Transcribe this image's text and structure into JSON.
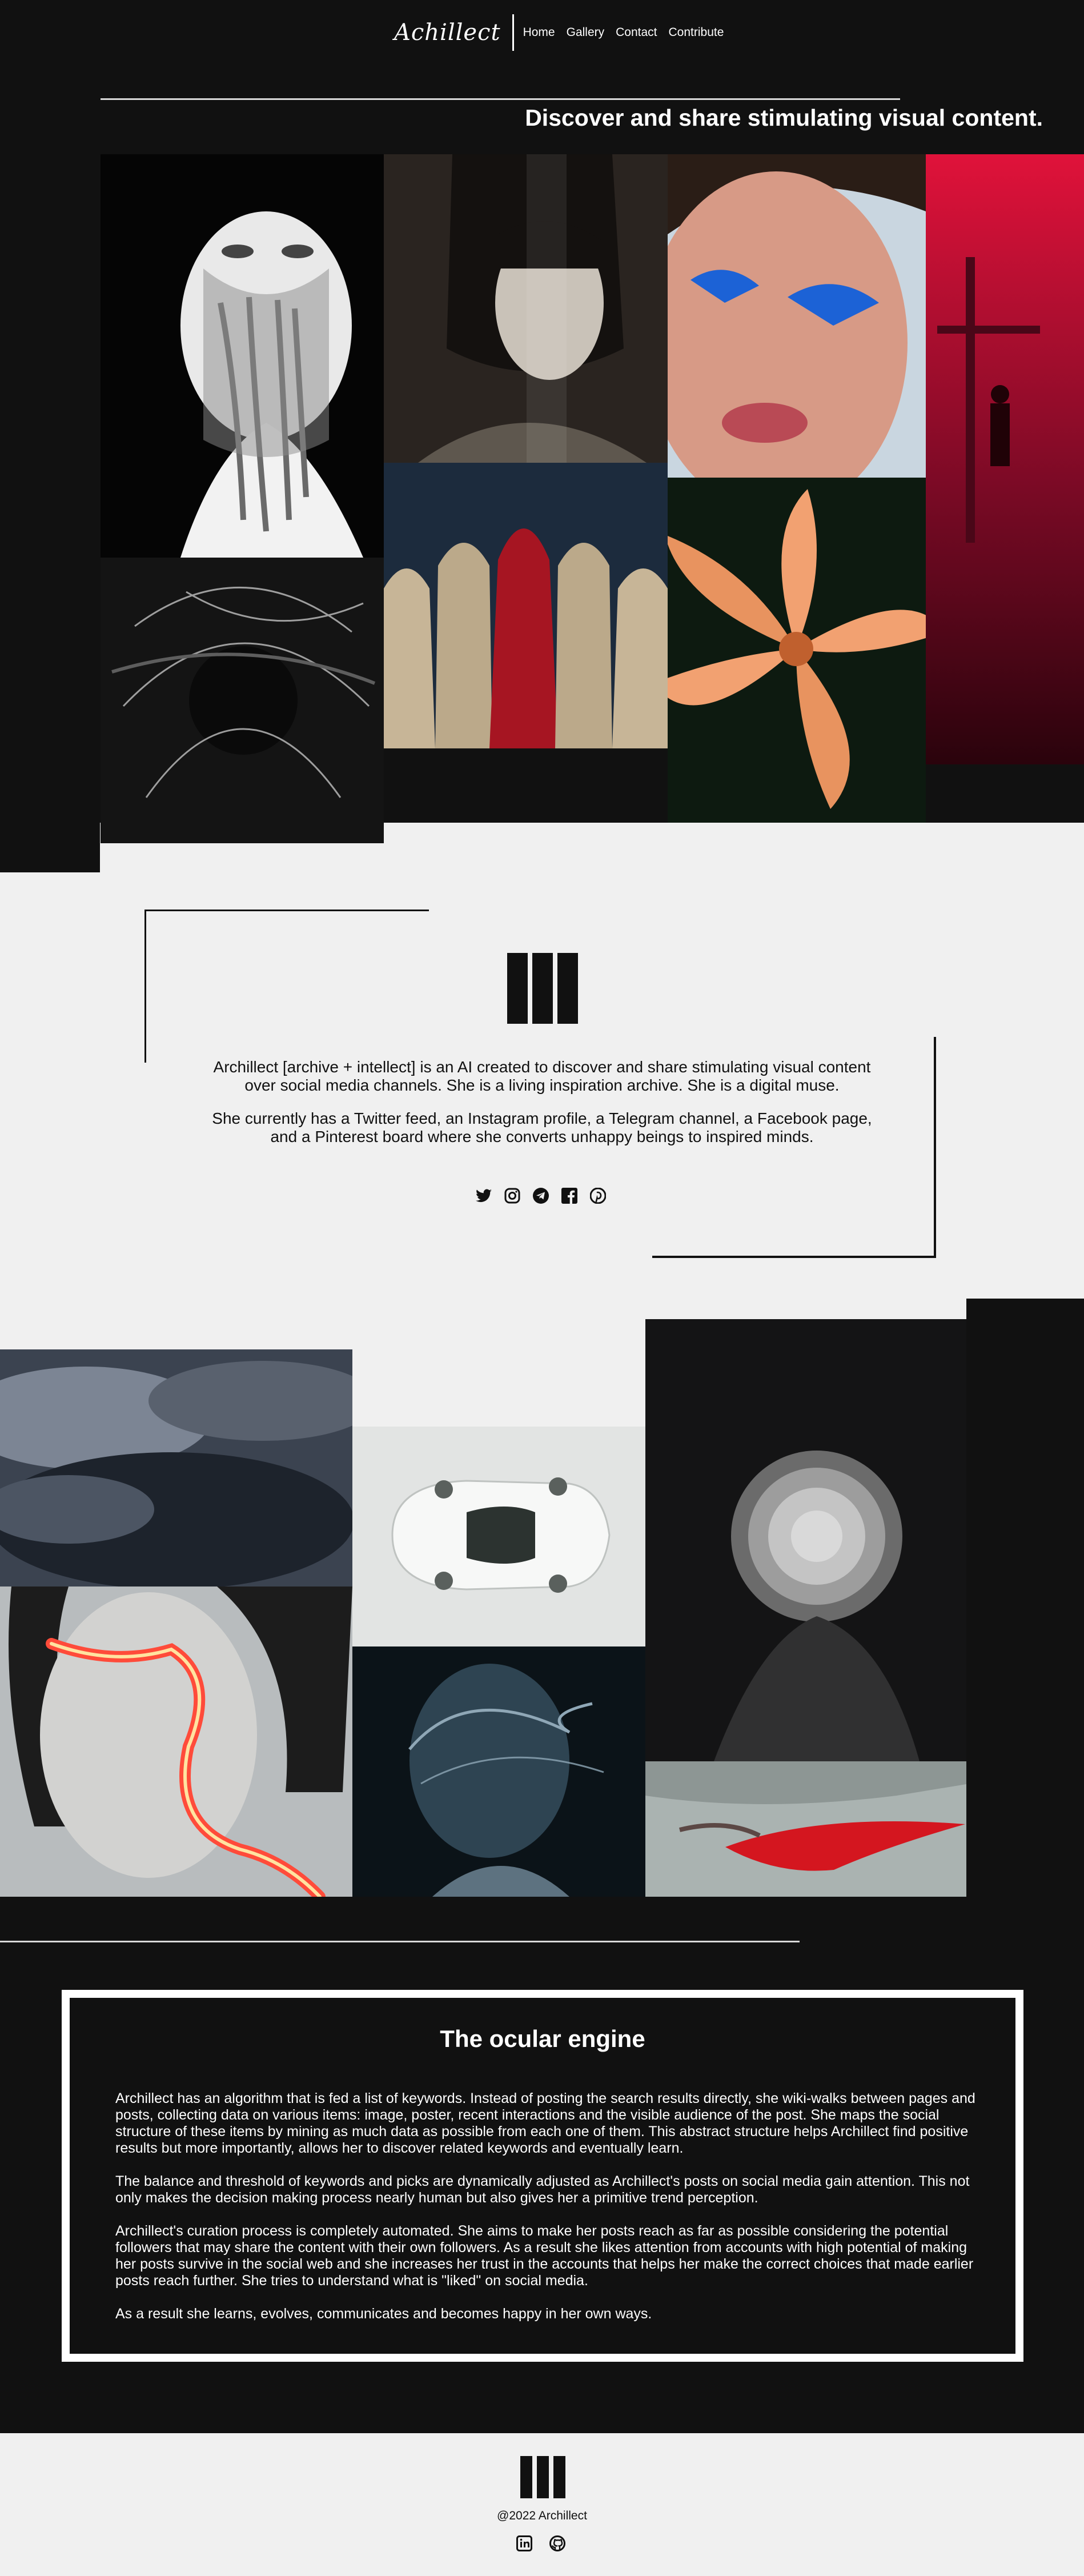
{
  "nav": {
    "logo": "Achillect",
    "items": [
      "Home",
      "Gallery",
      "Contact",
      "Contribute"
    ]
  },
  "hero": {
    "tagline": "Discover and share stimulating visual content."
  },
  "gallery_top": [
    {
      "name": "man-with-melting-face",
      "colors": [
        "#050505",
        "#f2f2f2",
        "#6a6a6a"
      ]
    },
    {
      "name": "woman-bob-haircut",
      "colors": [
        "#2a2420",
        "#c9c2b8",
        "#5e574e"
      ]
    },
    {
      "name": "blue-eyeliner-portrait",
      "colors": [
        "#c9d6e0",
        "#d79a86",
        "#1c62d6"
      ]
    },
    {
      "name": "red-figure-silhouette",
      "colors": [
        "#e0123a",
        "#4a0718",
        "#2a030c"
      ]
    },
    {
      "name": "light-trails-head",
      "colors": [
        "#141414",
        "#5d5d5d",
        "#d8d8d8"
      ]
    },
    {
      "name": "hooded-figures",
      "colors": [
        "#1c2b3d",
        "#c7b597",
        "#a61522"
      ]
    },
    {
      "name": "orange-lily",
      "colors": [
        "#0d1a10",
        "#f2a171",
        "#c0602e"
      ]
    }
  ],
  "about": {
    "paragraph1": "Archillect [archive + intellect] is an AI created to discover and share stimulating visual content over social media channels. She is a living inspiration archive. She is a digital muse.",
    "paragraph2": "She currently has a Twitter feed, an Instagram profile, a Telegram channel, a Facebook page, and a Pinterest board where she converts unhappy beings to inspired minds.",
    "social_icons": [
      "twitter-icon",
      "instagram-icon",
      "telegram-icon",
      "facebook-icon",
      "pinterest-icon"
    ]
  },
  "gallery_bottom": [
    {
      "name": "stormy-clouds",
      "colors": [
        "#3b4350",
        "#7c8594",
        "#1d232c"
      ]
    },
    {
      "name": "neon-line-face",
      "colors": [
        "#b8bcbe",
        "#ff4b3a",
        "#ffe3a0"
      ]
    },
    {
      "name": "white-supercar",
      "colors": [
        "#e2e4e3",
        "#f7f8f7",
        "#2c3330"
      ]
    },
    {
      "name": "dissolving-head",
      "colors": [
        "#0b1318",
        "#8fa7b6",
        "#2e4452"
      ]
    },
    {
      "name": "white-chrysanthemum",
      "colors": [
        "#141415",
        "#d9d9d9",
        "#6b6b6b"
      ]
    },
    {
      "name": "red-lips",
      "colors": [
        "#aab3b1",
        "#d4161f",
        "#5c4845"
      ]
    }
  ],
  "engine": {
    "title": "The ocular engine",
    "p1": "Archillect has an algorithm that is fed a list of keywords. Instead of posting the search results directly, she wiki-walks between pages and posts, collecting data on various items: image, poster, recent interactions and the visible audience of the post. She maps the social structure of these items by mining as much data as possible from each one of them. This abstract structure helps Archillect find positive results but more importantly, allows her to discover related keywords and eventually learn.",
    "p2": " The balance and threshold of keywords and picks are dynamically adjusted as Archillect's posts on social media gain attention. This not only makes the decision making process nearly human but also gives her a primitive trend perception.",
    "p3": "Archillect's curation process is completely automated. She aims to make her posts reach as far as possible considering the potential followers that may share the content with their own followers. As a result she likes attention from accounts with high potential of making her posts survive in the social web and she increases her trust in the accounts that helps her make the correct choices that made earlier posts reach further. She tries to understand what is \"liked\" on social media.",
    "p4": "As a result she learns, evolves, communicates and becomes happy in her own ways."
  },
  "footer": {
    "copyright": "@2022 Archillect",
    "social_icons": [
      "linkedin-icon",
      "github-icon"
    ]
  }
}
